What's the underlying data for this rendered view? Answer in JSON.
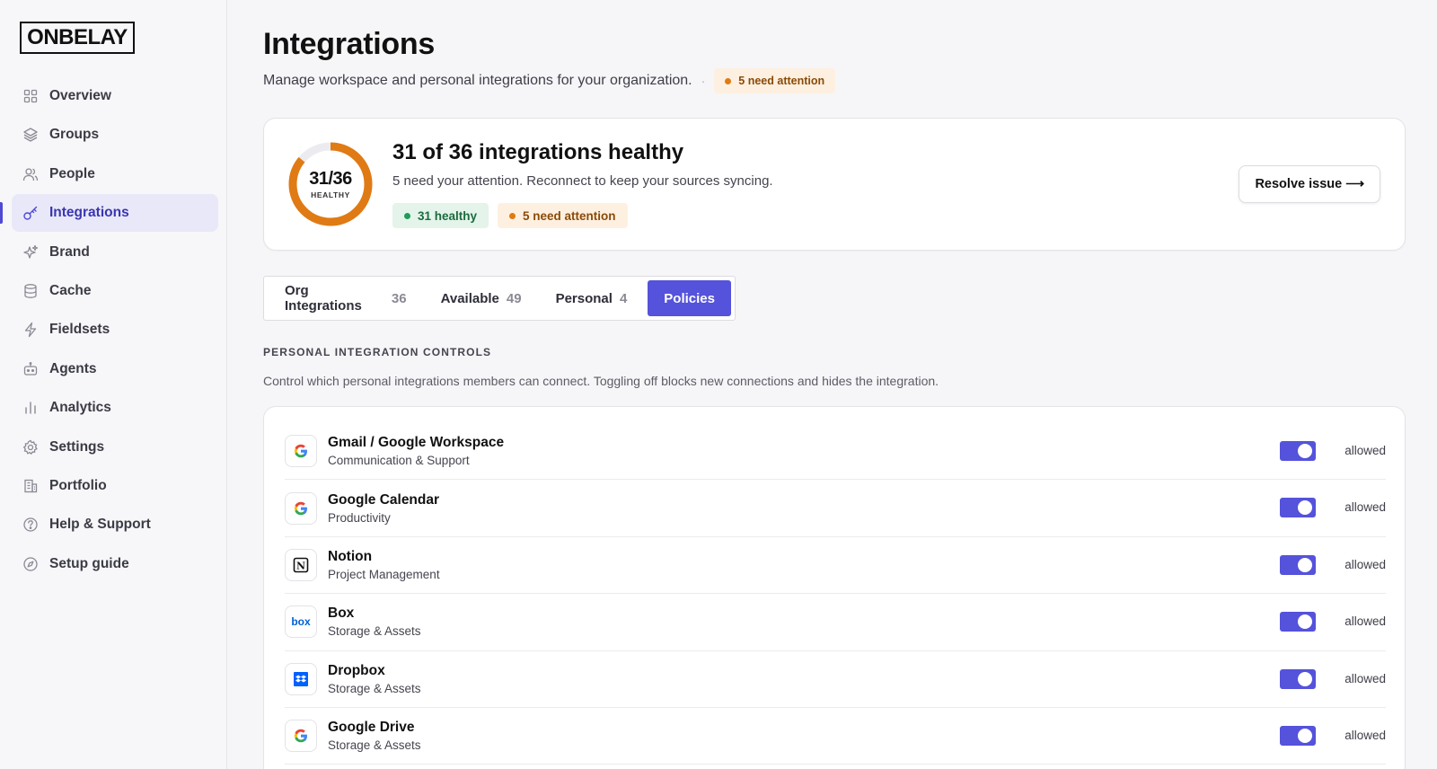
{
  "brand": {
    "logo_text": "ONBELAY"
  },
  "sidebar": {
    "items": [
      {
        "label": "Overview",
        "icon": "grid-icon"
      },
      {
        "label": "Groups",
        "icon": "layers-icon"
      },
      {
        "label": "People",
        "icon": "users-icon"
      },
      {
        "label": "Integrations",
        "icon": "key-icon",
        "active": true
      },
      {
        "label": "Brand",
        "icon": "sparkle-icon"
      },
      {
        "label": "Cache",
        "icon": "database-icon"
      },
      {
        "label": "Fieldsets",
        "icon": "bolt-icon"
      },
      {
        "label": "Agents",
        "icon": "robot-icon"
      },
      {
        "label": "Analytics",
        "icon": "bar-chart-icon"
      },
      {
        "label": "Settings",
        "icon": "gear-icon"
      },
      {
        "label": "Portfolio",
        "icon": "building-icon"
      },
      {
        "label": "Help & Support",
        "icon": "help-icon"
      },
      {
        "label": "Setup guide",
        "icon": "compass-icon"
      }
    ]
  },
  "header": {
    "title": "Integrations",
    "subtitle": "Manage workspace and personal integrations for your organization.",
    "separator": "·",
    "attention_badge": "5 need attention"
  },
  "health": {
    "ring_value": "31/36",
    "ring_label": "HEALTHY",
    "healthy_fraction": 0.861,
    "title": "31 of 36 integrations healthy",
    "subtitle": "5 need your attention. Reconnect to keep your sources syncing.",
    "healthy_badge": "31 healthy",
    "attention_badge": "5 need attention",
    "resolve_label": "Resolve issue ⟶",
    "colors": {
      "ring": "#e07a14",
      "track": "#ececf0"
    }
  },
  "tabs": [
    {
      "label": "Org Integrations",
      "count": "36"
    },
    {
      "label": "Available",
      "count": "49"
    },
    {
      "label": "Personal",
      "count": "4"
    },
    {
      "label": "Policies",
      "count": "",
      "active": true
    }
  ],
  "section": {
    "label": "PERSONAL INTEGRATION CONTROLS",
    "description": "Control which personal integrations members can connect. Toggling off blocks new connections and hides the integration."
  },
  "integrations": [
    {
      "name": "Gmail / Google Workspace",
      "category": "Communication & Support",
      "icon": "google-icon",
      "enabled": true,
      "status": "allowed"
    },
    {
      "name": "Google Calendar",
      "category": "Productivity",
      "icon": "google-icon",
      "enabled": true,
      "status": "allowed"
    },
    {
      "name": "Notion",
      "category": "Project Management",
      "icon": "notion-icon",
      "enabled": true,
      "status": "allowed"
    },
    {
      "name": "Box",
      "category": "Storage & Assets",
      "icon": "box-icon",
      "enabled": true,
      "status": "allowed"
    },
    {
      "name": "Dropbox",
      "category": "Storage & Assets",
      "icon": "dropbox-icon",
      "enabled": true,
      "status": "allowed"
    },
    {
      "name": "Google Drive",
      "category": "Storage & Assets",
      "icon": "google-icon",
      "enabled": true,
      "status": "allowed"
    }
  ],
  "icon_text": {
    "notion": "N",
    "box": "box"
  },
  "colors": {
    "accent": "#5552db",
    "healthy": "#1f9d58",
    "attention": "#e07a14"
  }
}
